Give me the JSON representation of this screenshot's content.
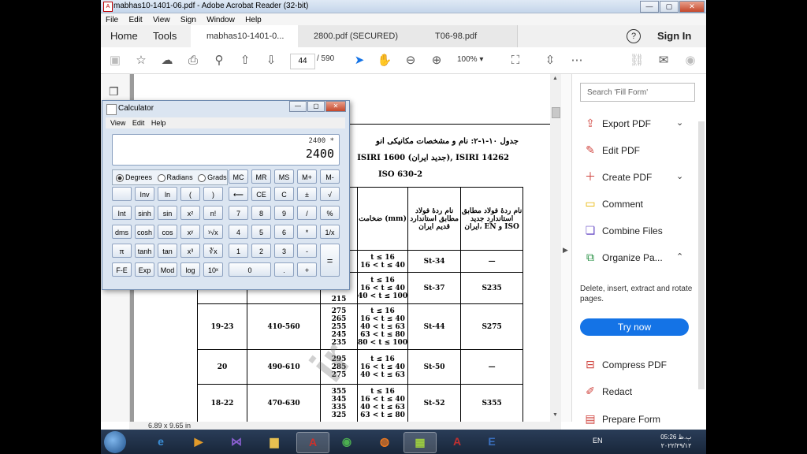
{
  "window": {
    "title": "mabhas10-1401-06.pdf - Adobe Acrobat Reader (32-bit)",
    "controls": {
      "minimize": "—",
      "restore": "▢",
      "close": "✕"
    }
  },
  "menu": [
    "File",
    "Edit",
    "View",
    "Sign",
    "Window",
    "Help"
  ],
  "tabs": {
    "home": "Home",
    "tools": "Tools",
    "docs": [
      {
        "label": "mabhas10-1401-0...",
        "active": true
      },
      {
        "label": "2800.pdf (SECURED)",
        "active": false
      },
      {
        "label": "T06-98.pdf",
        "active": false
      }
    ],
    "help_icon": "?",
    "signin": "Sign In"
  },
  "toolbar": {
    "page_current": "44",
    "page_total": "/ 590",
    "zoom": "100%"
  },
  "search": {
    "placeholder": "Search 'Fill Form'"
  },
  "right_tools": [
    {
      "label": "Export PDF",
      "icon": "export-pdf-icon",
      "glyph": "⇪",
      "color": "#d0443e",
      "chev": "⌄"
    },
    {
      "label": "Edit PDF",
      "icon": "edit-pdf-icon",
      "glyph": "✎",
      "color": "#d0443e",
      "chev": ""
    },
    {
      "label": "Create PDF",
      "icon": "create-pdf-icon",
      "glyph": "＋",
      "color": "#d0443e",
      "chev": "⌄"
    },
    {
      "label": "Comment",
      "icon": "comment-icon",
      "glyph": "▭",
      "color": "#e8b400",
      "chev": ""
    },
    {
      "label": "Combine Files",
      "icon": "combine-files-icon",
      "glyph": "❏",
      "color": "#6b4fc7",
      "chev": ""
    },
    {
      "label": "Organize Pa...",
      "icon": "organize-pages-icon",
      "glyph": "⧉",
      "color": "#1e8c3c",
      "chev": "⌃"
    }
  ],
  "organize_desc": "Delete, insert, extract and rotate pages.",
  "try_now": "Try now",
  "more_tools": [
    {
      "label": "Compress PDF",
      "icon": "compress-pdf-icon",
      "glyph": "⊟",
      "color": "#d0443e"
    },
    {
      "label": "Redact",
      "icon": "redact-icon",
      "glyph": "✐",
      "color": "#d0443e"
    },
    {
      "label": "Prepare Form",
      "icon": "prepare-form-icon",
      "glyph": "▤",
      "color": "#d0443e"
    }
  ],
  "document": {
    "heading": "جدول ۱۰-۱-۲: نام و مشخصات مکانیکی انو",
    "line2": "ISIRI 1600 (جدید ایران), ISIRI 14262",
    "line3": "ISO 630-2",
    "table_headers": [
      "ضخامت (mm)",
      "نام ردهٔ فولاد مطابق استاندارد قدیم ایران",
      "نام ردهٔ فولاد مطابق استاندارد جدید ایران، EN و ISO"
    ],
    "rows": [
      {
        "c1": "",
        "c2": "",
        "c3": "",
        "c4": "t ≤ 16\n16 < t ≤ 40",
        "c5": "St-34",
        "c6": "—"
      },
      {
        "c1": "",
        "c2": "",
        "c3": "215",
        "c4": "t ≤ 16\n16 < t ≤ 40\n40 < t ≤ 100",
        "c5": "St-37",
        "c6": "S235"
      },
      {
        "c1": "19-23",
        "c2": "410-560",
        "c3": "275\n265\n255\n245\n235",
        "c4": "t ≤ 16\n16 < t ≤ 40\n40 < t ≤ 63\n63 < t ≤ 80\n80 < t ≤ 100",
        "c5": "St-44",
        "c6": "S275"
      },
      {
        "c1": "20",
        "c2": "490-610",
        "c3": "295\n285\n275",
        "c4": "t ≤ 16\n16 < t ≤ 40\n40 < t ≤ 63",
        "c5": "St-50",
        "c6": "—"
      },
      {
        "c1": "18-22",
        "c2": "470-630",
        "c3": "355\n345\n335\n325",
        "c4": "t ≤ 16\n16 < t ≤ 40\n40 < t ≤ 63\n63 < t ≤ 80",
        "c5": "St-52",
        "c6": "S355"
      }
    ],
    "watermark": "ir",
    "page_size": "6.89 x 9.65 in"
  },
  "calculator": {
    "title": "Calculator",
    "menu": [
      "View",
      "Edit",
      "Help"
    ],
    "expression": "2400 *",
    "value": "2400",
    "angle_modes": [
      "Degrees",
      "Radians",
      "Grads"
    ],
    "keys_top": [
      "MC",
      "MR",
      "MS",
      "M+",
      "M-"
    ],
    "grid": [
      [
        "",
        "Inv",
        "ln",
        "(",
        ")",
        "⟵",
        "CE",
        "C",
        "±",
        "√"
      ],
      [
        "Int",
        "sinh",
        "sin",
        "x²",
        "n!",
        "7",
        "8",
        "9",
        "/",
        "%"
      ],
      [
        "dms",
        "cosh",
        "cos",
        "xʸ",
        "ʸ√x",
        "4",
        "5",
        "6",
        "*",
        "1/x"
      ],
      [
        "π",
        "tanh",
        "tan",
        "x³",
        "∛x",
        "1",
        "2",
        "3",
        "-",
        "="
      ],
      [
        "F-E",
        "Exp",
        "Mod",
        "log",
        "10ˣ",
        "0",
        "",
        ".",
        "+",
        ""
      ]
    ]
  },
  "taskbar": {
    "apps": [
      {
        "name": "ie",
        "glyph": "e",
        "color": "#3a8fd8"
      },
      {
        "name": "media-player",
        "glyph": "▶",
        "color": "#e09a2a"
      },
      {
        "name": "visual-studio",
        "glyph": "⋈",
        "color": "#8a5fd0"
      },
      {
        "name": "file-explorer",
        "glyph": "▆",
        "color": "#e8c050"
      },
      {
        "name": "acrobat",
        "glyph": "A",
        "color": "#d0302a"
      },
      {
        "name": "chrome",
        "glyph": "◉",
        "color": "#4caf50"
      },
      {
        "name": "firefox",
        "glyph": "◍",
        "color": "#f07a20"
      },
      {
        "name": "calculator",
        "glyph": "▦",
        "color": "#9ccc40"
      },
      {
        "name": "autocad",
        "glyph": "A",
        "color": "#c23030"
      },
      {
        "name": "etabs",
        "glyph": "E",
        "color": "#3a70c0"
      }
    ],
    "lang": "EN",
    "time": "05:26 ب.ظ",
    "date": "۲۰۲۲/۲۹/۱۲"
  }
}
